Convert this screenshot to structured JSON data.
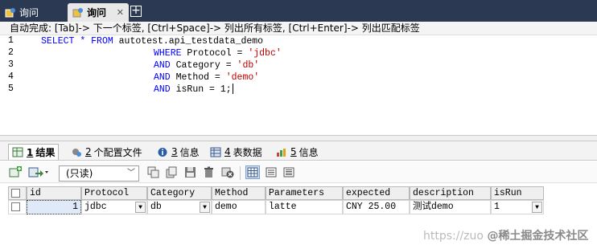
{
  "tabs": [
    {
      "label": "询问",
      "active": false
    },
    {
      "label": "询问",
      "active": true,
      "close": "✕"
    }
  ],
  "new_tab_symbol": "+",
  "hint": "自动完成: [Tab]-> 下一个标签, [Ctrl+Space]-> 列出所有标签, [Ctrl+Enter]-> 列出匹配标签",
  "editor": {
    "lines": [
      {
        "n": "1"
      },
      {
        "n": "2"
      },
      {
        "n": "3"
      },
      {
        "n": "4"
      },
      {
        "n": "5"
      }
    ],
    "l1_kw1": "SELECT",
    "l1_star": " * ",
    "l1_kw2": "FROM",
    "l1_tail": " autotest.api_testdata_demo",
    "l2_kw": "WHERE",
    "l2_mid": " Protocol = ",
    "l2_str": "'jdbc'",
    "l3_kw": "AND",
    "l3_mid": " Category = ",
    "l3_str": "'db'",
    "l4_kw": "AND",
    "l4_mid": " Method = ",
    "l4_str": "'demo'",
    "l5_kw": "AND",
    "l5_mid": " isRun = 1;"
  },
  "result_tabs": [
    {
      "num": "1",
      "label": "结果",
      "icon": "table-result-icon"
    },
    {
      "num": "2",
      "label": "个配置文件",
      "icon": "profile-icon"
    },
    {
      "num": "3",
      "label": "信息",
      "icon": "info-icon"
    },
    {
      "num": "4",
      "label": "表数据",
      "icon": "table-data-icon"
    },
    {
      "num": "5",
      "label": "信息",
      "icon": "info-chart-icon"
    }
  ],
  "toolbar": {
    "readonly_option": "(只读)"
  },
  "grid": {
    "columns": [
      "id",
      "Protocol",
      "Category",
      "Method",
      "Parameters",
      "expected",
      "description",
      "isRun"
    ],
    "row": [
      "1",
      "jdbc",
      "db",
      "demo",
      "latte",
      "CNY 25.00",
      "测试demo",
      "1"
    ]
  },
  "watermark": {
    "url": "https://zuo",
    "brand": "@稀土掘金技术社区"
  },
  "colors": {
    "tabbar": "#2b3a52",
    "keyword": "#0000ff",
    "string": "#c00000"
  }
}
